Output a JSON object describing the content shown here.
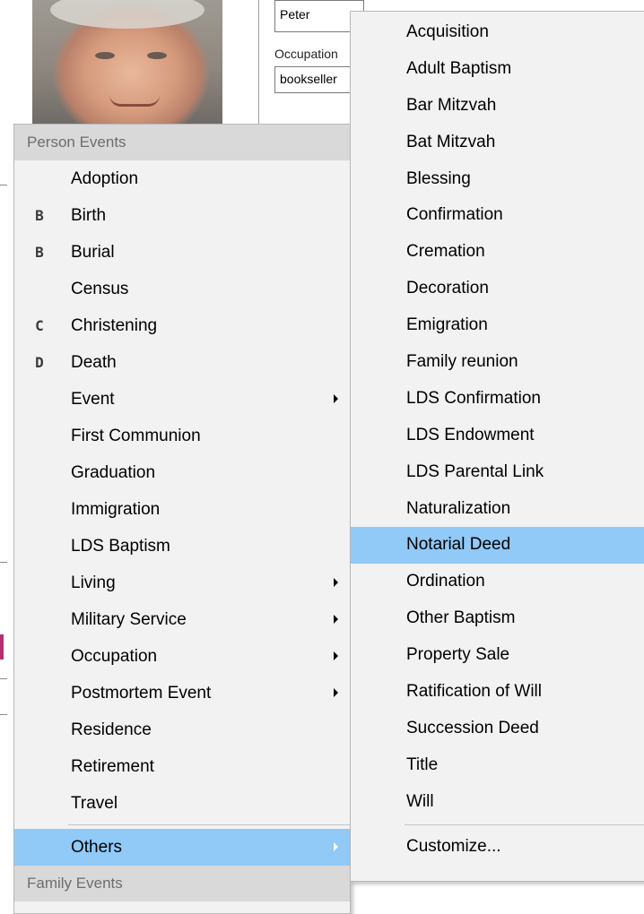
{
  "form": {
    "name_value": "Peter",
    "occupation_label": "Occupation",
    "occupation_value": "bookseller"
  },
  "person_menu": {
    "header": "Person Events",
    "items": [
      {
        "label": "Adoption",
        "shortcut": "",
        "has_submenu": false
      },
      {
        "label": "Birth",
        "shortcut": "B",
        "has_submenu": false
      },
      {
        "label": "Burial",
        "shortcut": "B",
        "has_submenu": false
      },
      {
        "label": "Census",
        "shortcut": "",
        "has_submenu": false
      },
      {
        "label": "Christening",
        "shortcut": "C",
        "has_submenu": false
      },
      {
        "label": "Death",
        "shortcut": "D",
        "has_submenu": false
      },
      {
        "label": "Event",
        "shortcut": "",
        "has_submenu": true
      },
      {
        "label": "First Communion",
        "shortcut": "",
        "has_submenu": false
      },
      {
        "label": "Graduation",
        "shortcut": "",
        "has_submenu": false
      },
      {
        "label": "Immigration",
        "shortcut": "",
        "has_submenu": false
      },
      {
        "label": "LDS Baptism",
        "shortcut": "",
        "has_submenu": false
      },
      {
        "label": "Living",
        "shortcut": "",
        "has_submenu": true
      },
      {
        "label": "Military Service",
        "shortcut": "",
        "has_submenu": true
      },
      {
        "label": "Occupation",
        "shortcut": "",
        "has_submenu": true
      },
      {
        "label": "Postmortem Event",
        "shortcut": "",
        "has_submenu": true
      },
      {
        "label": "Residence",
        "shortcut": "",
        "has_submenu": false
      },
      {
        "label": "Retirement",
        "shortcut": "",
        "has_submenu": false
      },
      {
        "label": "Travel",
        "shortcut": "",
        "has_submenu": false
      }
    ],
    "others_label": "Others",
    "family_header": "Family Events"
  },
  "others_submenu": {
    "items": [
      "Acquisition",
      "Adult Baptism",
      "Bar Mitzvah",
      "Bat Mitzvah",
      "Blessing",
      "Confirmation",
      "Cremation",
      "Decoration",
      "Emigration",
      "Family reunion",
      "LDS Confirmation",
      "LDS Endowment",
      "LDS Parental Link",
      "Naturalization",
      "Notarial Deed",
      "Ordination",
      "Other Baptism",
      "Property Sale",
      "Ratification of Will",
      "Succession Deed",
      "Title",
      "Will"
    ],
    "highlighted": "Notarial Deed",
    "customize_label": "Customize..."
  },
  "colors": {
    "highlight": "#91c9f7",
    "menu_background": "#f2f2f2",
    "section_header": "#d9d9d9"
  }
}
